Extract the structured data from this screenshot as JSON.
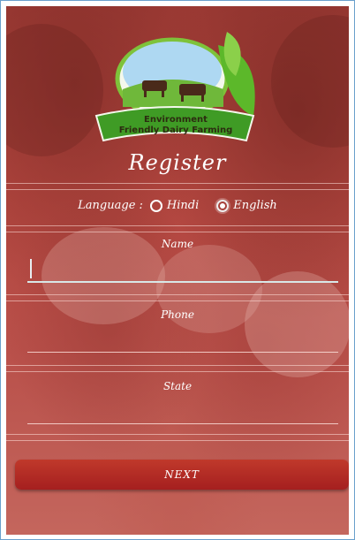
{
  "logo": {
    "line1": "Environment",
    "line2": "Friendly Dairy Farming"
  },
  "title": "Register",
  "language": {
    "label": "Language :",
    "options": [
      "Hindi",
      "English"
    ],
    "selected": "English"
  },
  "fields": {
    "name": {
      "label": "Name",
      "value": ""
    },
    "phone": {
      "label": "Phone",
      "value": ""
    },
    "state": {
      "label": "State",
      "value": ""
    }
  },
  "next_label": "NEXT",
  "colors": {
    "overlay": "#b3463f",
    "button": "#b22222",
    "logo_green": "#4caf2a"
  }
}
